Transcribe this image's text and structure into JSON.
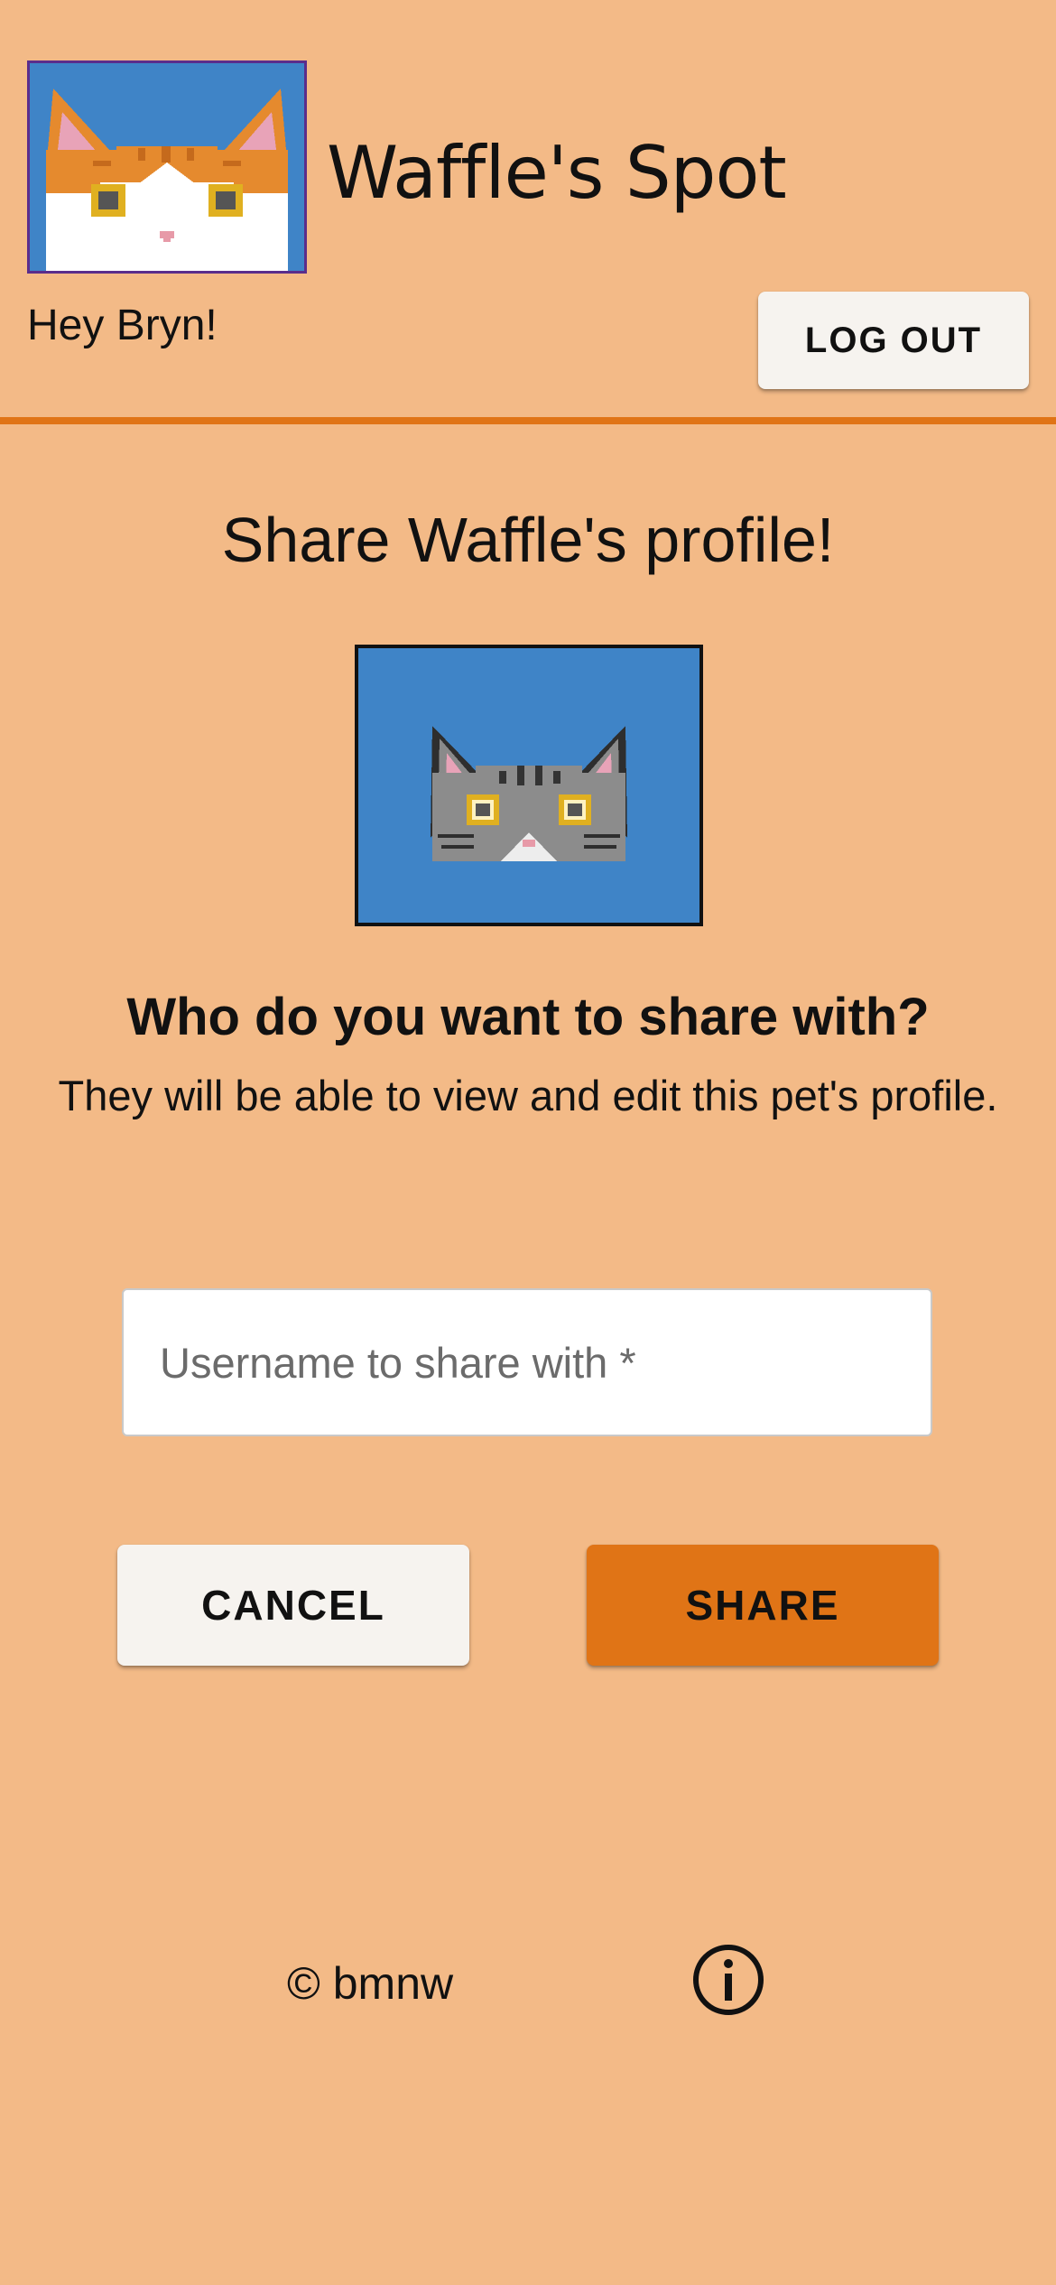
{
  "header": {
    "app_title": "Waffle's Spot",
    "greeting": "Hey Bryn!",
    "logout_label": "LOG OUT",
    "logo_icon": "orange-white-cat-pixel-icon"
  },
  "share": {
    "title": "Share Waffle's profile!",
    "pet_avatar_icon": "gray-tabby-cat-pixel-icon",
    "heading": "Who do you want to share with?",
    "subtext": "They will be able to view and edit this pet's profile.",
    "username_placeholder": "Username to share with *",
    "username_value": "",
    "cancel_label": "CANCEL",
    "share_label": "SHARE"
  },
  "footer": {
    "copyright": "© bmnw",
    "info_icon": "info-icon"
  },
  "colors": {
    "background": "#F3BA87",
    "accent": "#E07416",
    "avatar_bg": "#3F84C7",
    "button_light": "#F6F3EF"
  }
}
